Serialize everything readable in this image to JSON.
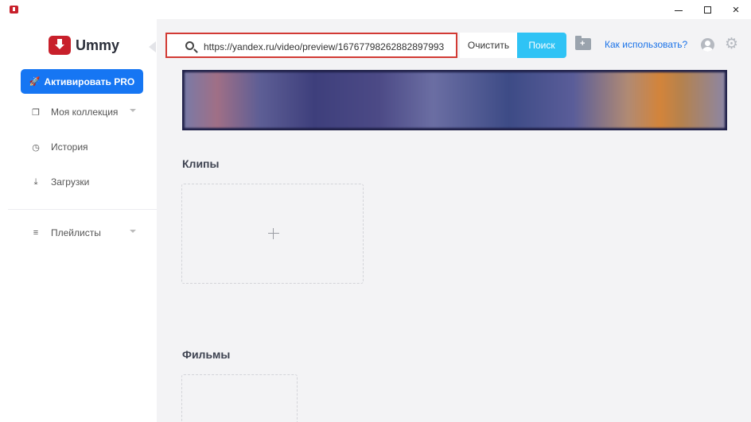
{
  "window": {
    "controls": {
      "minimize": "minimize-icon",
      "maximize": "maximize-icon",
      "close": "×"
    }
  },
  "sidebar": {
    "logo_text": "Ummy",
    "pro_button": "Активировать PRO",
    "items": [
      {
        "label": "Моя коллекция",
        "icon": "collection-icon"
      },
      {
        "label": "История",
        "icon": "history-icon"
      },
      {
        "label": "Загрузки",
        "icon": "download-icon"
      },
      {
        "label": "Плейлисты",
        "icon": "playlist-icon"
      }
    ]
  },
  "toolbar": {
    "search_value": "https://yandex.ru/video/preview/16767798262882897993",
    "clear_label": "Очистить",
    "search_label": "Поиск",
    "howto_link": "Как использовать?"
  },
  "content": {
    "clips_title": "Клипы",
    "films_title": "Фильмы"
  },
  "colors": {
    "brand_red": "#c8202b",
    "pro_blue": "#1676f3",
    "search_cyan": "#2fc3f5",
    "link_blue": "#1b73e8",
    "highlight_red": "#d23a34"
  }
}
